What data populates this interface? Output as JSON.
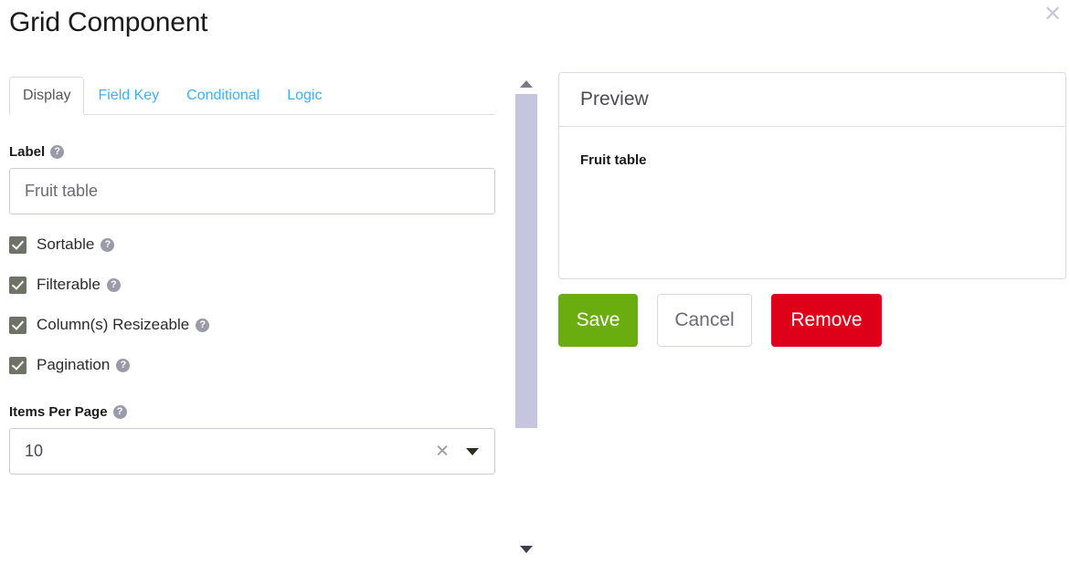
{
  "window": {
    "title": "Grid Component",
    "close_icon": "close-icon",
    "close_glyph": "✕"
  },
  "tabs": [
    {
      "label": "Display",
      "active": true
    },
    {
      "label": "Field Key",
      "active": false
    },
    {
      "label": "Conditional",
      "active": false
    },
    {
      "label": "Logic",
      "active": false
    }
  ],
  "form": {
    "label_field": {
      "label": "Label",
      "help_glyph": "?",
      "value": "Fruit table",
      "placeholder": "Fruit table"
    },
    "checkboxes": [
      {
        "label": "Sortable",
        "checked": true,
        "help_glyph": "?"
      },
      {
        "label": "Filterable",
        "checked": true,
        "help_glyph": "?"
      },
      {
        "label": "Column(s) Resizeable",
        "checked": true,
        "help_glyph": "?"
      },
      {
        "label": "Pagination",
        "checked": true,
        "help_glyph": "?"
      }
    ],
    "items_per_page": {
      "label": "Items Per Page",
      "help_glyph": "?",
      "value": "10",
      "clear_glyph": "✕",
      "options": [
        "10"
      ]
    }
  },
  "scrollbar": {
    "up_arrow_icon": "caret-up-icon",
    "down_arrow_icon": "caret-down-icon",
    "thumb_icon": "scrollbar-thumb"
  },
  "preview": {
    "title": "Preview",
    "field_title": "Fruit table"
  },
  "actions": {
    "save_label": "Save",
    "cancel_label": "Cancel",
    "remove_label": "Remove"
  },
  "colors": {
    "tab_link": "#3cb0fd",
    "save_green": "#6aad0f",
    "remove_red": "#dd0018",
    "checkbox_fill": "#6f7266",
    "border_lavender": "#dcdce8",
    "scrollbar_thumb": "#c5c5e0"
  }
}
